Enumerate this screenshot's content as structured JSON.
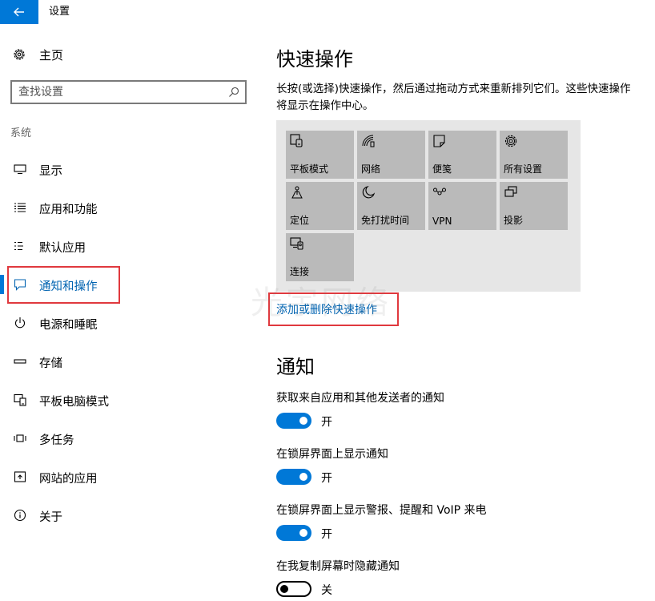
{
  "window": {
    "title": "设置",
    "accent": "#0078d7",
    "back_icon": "back-arrow-icon"
  },
  "sidebar": {
    "home": {
      "label": "主页",
      "icon": "gear-icon"
    },
    "search": {
      "placeholder": "查找设置",
      "value": "",
      "icon": "search-icon"
    },
    "section": "系统",
    "items": [
      {
        "label": "显示",
        "icon": "monitor-icon",
        "active": false
      },
      {
        "label": "应用和功能",
        "icon": "list-icon",
        "active": false
      },
      {
        "label": "默认应用",
        "icon": "default-apps-icon",
        "active": false
      },
      {
        "label": "通知和操作",
        "icon": "notification-icon",
        "active": true
      },
      {
        "label": "电源和睡眠",
        "icon": "power-icon",
        "active": false
      },
      {
        "label": "存储",
        "icon": "storage-icon",
        "active": false
      },
      {
        "label": "平板电脑模式",
        "icon": "tablet-mode-icon",
        "active": false
      },
      {
        "label": "多任务",
        "icon": "multitask-icon",
        "active": false
      },
      {
        "label": "网站的应用",
        "icon": "website-apps-icon",
        "active": false
      },
      {
        "label": "关于",
        "icon": "info-icon",
        "active": false
      }
    ]
  },
  "quick_actions": {
    "title": "快速操作",
    "description": "长按(或选择)快速操作，然后通过拖动方式来重新排列它们。这些快速操作将显示在操作中心。",
    "tiles": [
      {
        "label": "平板模式",
        "icon": "tablet-icon"
      },
      {
        "label": "网络",
        "icon": "network-icon"
      },
      {
        "label": "便笺",
        "icon": "note-icon"
      },
      {
        "label": "所有设置",
        "icon": "gear-icon"
      },
      {
        "label": "定位",
        "icon": "location-icon"
      },
      {
        "label": "免打扰时间",
        "icon": "moon-icon"
      },
      {
        "label": "VPN",
        "icon": "vpn-icon"
      },
      {
        "label": "投影",
        "icon": "project-icon"
      },
      {
        "label": "连接",
        "icon": "connect-icon"
      }
    ],
    "link": "添加或删除快速操作"
  },
  "notifications": {
    "title": "通知",
    "settings": [
      {
        "label": "获取来自应用和其他发送者的通知",
        "on": true,
        "state": "开"
      },
      {
        "label": "在锁屏界面上显示通知",
        "on": true,
        "state": "开"
      },
      {
        "label": "在锁屏界面上显示警报、提醒和 VoIP 来电",
        "on": true,
        "state": "开"
      },
      {
        "label": "在我复制屏幕时隐藏通知",
        "on": false,
        "state": "关"
      }
    ]
  },
  "watermark": "光宇网络",
  "colors": {
    "highlight": "#e0393e",
    "link": "#0063b1",
    "tile": "#bababa",
    "panel": "#e6e6e6"
  }
}
